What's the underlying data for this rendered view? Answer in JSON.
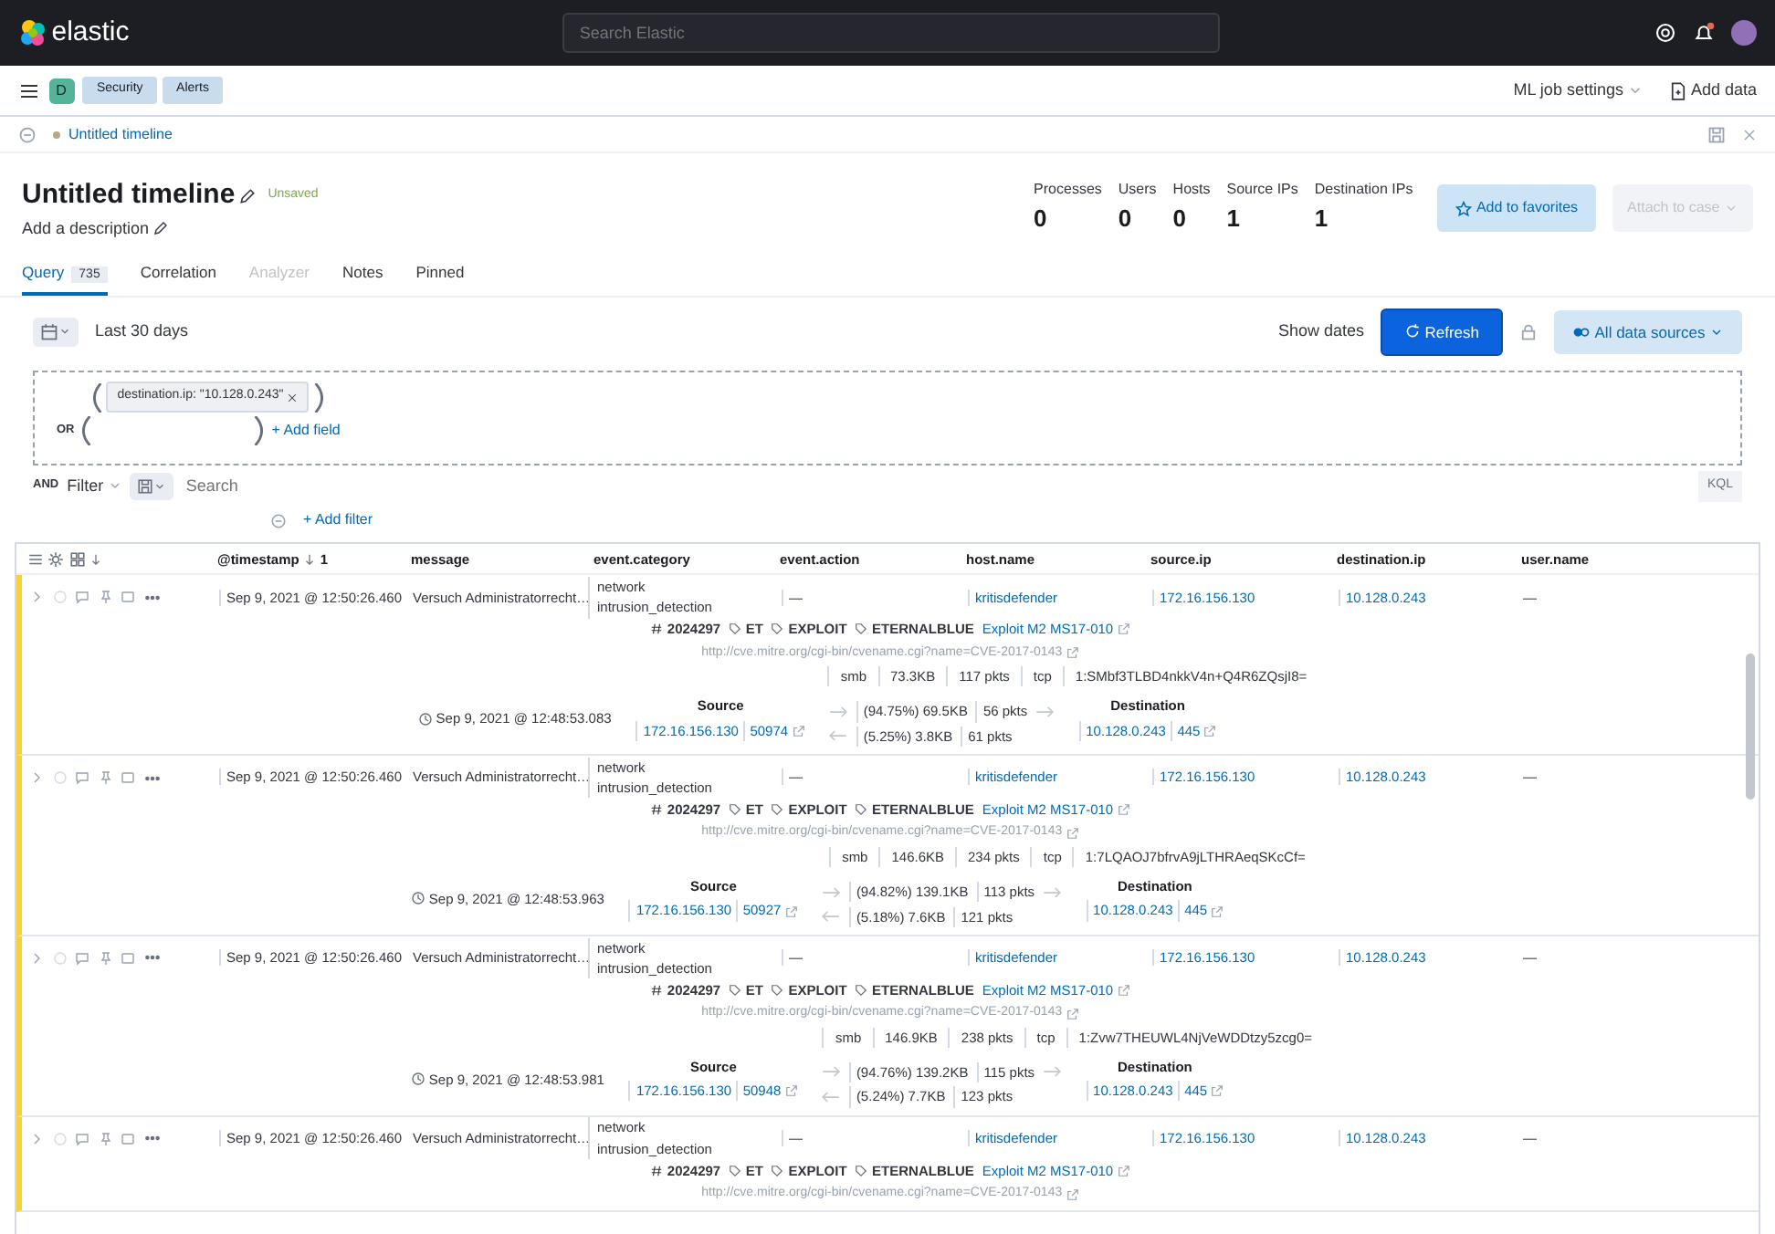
{
  "header": {
    "logo": "elastic",
    "search_placeholder": "Search Elastic"
  },
  "nav": {
    "space_badge": "D",
    "breadcrumbs": [
      "Security",
      "Alerts"
    ],
    "links": [
      {
        "label": "ML job settings",
        "kind": "dropdown"
      },
      {
        "label": "Add data",
        "kind": "add"
      }
    ]
  },
  "timeline_bar": {
    "title": "Untitled timeline"
  },
  "timeline": {
    "title": "Untitled timeline",
    "status": "Unsaved",
    "description": "Add a description",
    "stats": [
      {
        "label": "Processes",
        "value": "0"
      },
      {
        "label": "Users",
        "value": "0"
      },
      {
        "label": "Hosts",
        "value": "0"
      },
      {
        "label": "Source IPs",
        "value": "1"
      },
      {
        "label": "Destination IPs",
        "value": "1"
      }
    ],
    "buttons": [
      {
        "label": "Add to favorites",
        "kind": "favorite",
        "disabled": false
      },
      {
        "label": "Attach to case",
        "kind": "dropdown",
        "disabled": true
      }
    ]
  },
  "tabs": [
    {
      "label": "Query",
      "count": "735",
      "selected": true,
      "disabled": false
    },
    {
      "label": "Correlation",
      "selected": false,
      "disabled": false
    },
    {
      "label": "Analyzer",
      "selected": false,
      "disabled": true
    },
    {
      "label": "Notes",
      "selected": false,
      "disabled": false
    },
    {
      "label": "Pinned",
      "selected": false,
      "disabled": false
    }
  ],
  "date_bar": {
    "range": "Last 30 days",
    "show_dates": "Show dates",
    "refresh": "Refresh",
    "data_sources": "All data sources"
  },
  "query_builder": {
    "pills": [
      "destination.ip: \"10.128.0.243\""
    ],
    "or_label": "OR",
    "add_field": "+ Add field"
  },
  "filter_bar": {
    "and_label": "AND",
    "filter": "Filter",
    "placeholder": "Search",
    "language": "KQL",
    "add_filter": "+ Add filter"
  },
  "table": {
    "columns": [
      {
        "label": "@timestamp",
        "sort_order": "1"
      },
      {
        "label": "message"
      },
      {
        "label": "event.category"
      },
      {
        "label": "event.action"
      },
      {
        "label": "host.name"
      },
      {
        "label": "source.ip"
      },
      {
        "label": "destination.ip"
      },
      {
        "label": "user.name"
      }
    ],
    "rows": [
      {
        "timestamp": "Sep 9, 2021 @ 12:50:26.460",
        "message": "Versuch Administratorrecht…",
        "category": [
          "network",
          "intrusion_detection"
        ],
        "action": "—",
        "host": "kritisdefender",
        "source_ip": "172.16.156.130",
        "destination_ip": "10.128.0.243",
        "user": "—",
        "signature": {
          "id": "2024297",
          "tags": [
            "ET",
            "EXPLOIT",
            "ETERNALBLUE"
          ],
          "link": "Exploit M2 MS17-010",
          "url": "http://cve.mitre.org/cgi-bin/cvename.cgi?name=CVE-2017-0143"
        },
        "network": {
          "protocol": "smb",
          "bytes": "73.3KB",
          "packets": "117 pkts",
          "transport": "tcp",
          "community_id": "1:SMbf3TLBD4nkkV4n+Q4R6ZQsjI8="
        },
        "flow": {
          "time": "Sep 9, 2021 @ 12:48:53.083",
          "source_label": "Source",
          "source_ip": "172.16.156.130",
          "source_port": "50974",
          "out_bytes": "(94.75%) 69.5KB",
          "out_packets": "56 pkts",
          "in_bytes": "(5.25%) 3.8KB",
          "in_packets": "61 pkts",
          "destination_label": "Destination",
          "destination_ip": "10.128.0.243",
          "destination_port": "445"
        }
      },
      {
        "timestamp": "Sep 9, 2021 @ 12:50:26.460",
        "message": "Versuch Administratorrecht…",
        "category": [
          "network",
          "intrusion_detection"
        ],
        "action": "—",
        "host": "kritisdefender",
        "source_ip": "172.16.156.130",
        "destination_ip": "10.128.0.243",
        "user": "—",
        "signature": {
          "id": "2024297",
          "tags": [
            "ET",
            "EXPLOIT",
            "ETERNALBLUE"
          ],
          "link": "Exploit M2 MS17-010",
          "url": "http://cve.mitre.org/cgi-bin/cvename.cgi?name=CVE-2017-0143"
        },
        "network": {
          "protocol": "smb",
          "bytes": "146.6KB",
          "packets": "234 pkts",
          "transport": "tcp",
          "community_id": "1:7LQAOJ7bfrvA9jLTHRAeqSKcCf="
        },
        "flow": {
          "time": "Sep 9, 2021 @ 12:48:53.963",
          "source_label": "Source",
          "source_ip": "172.16.156.130",
          "source_port": "50927",
          "out_bytes": "(94.82%) 139.1KB",
          "out_packets": "113 pkts",
          "in_bytes": "(5.18%) 7.6KB",
          "in_packets": "121 pkts",
          "destination_label": "Destination",
          "destination_ip": "10.128.0.243",
          "destination_port": "445"
        }
      },
      {
        "timestamp": "Sep 9, 2021 @ 12:50:26.460",
        "message": "Versuch Administratorrecht…",
        "category": [
          "network",
          "intrusion_detection"
        ],
        "action": "—",
        "host": "kritisdefender",
        "source_ip": "172.16.156.130",
        "destination_ip": "10.128.0.243",
        "user": "—",
        "signature": {
          "id": "2024297",
          "tags": [
            "ET",
            "EXPLOIT",
            "ETERNALBLUE"
          ],
          "link": "Exploit M2 MS17-010",
          "url": "http://cve.mitre.org/cgi-bin/cvename.cgi?name=CVE-2017-0143"
        },
        "network": {
          "protocol": "smb",
          "bytes": "146.9KB",
          "packets": "238 pkts",
          "transport": "tcp",
          "community_id": "1:Zvw7THEUWL4NjVeWDDtzy5zcg0="
        },
        "flow": {
          "time": "Sep 9, 2021 @ 12:48:53.981",
          "source_label": "Source",
          "source_ip": "172.16.156.130",
          "source_port": "50948",
          "out_bytes": "(94.76%) 139.2KB",
          "out_packets": "115 pkts",
          "in_bytes": "(5.24%) 7.7KB",
          "in_packets": "123 pkts",
          "destination_label": "Destination",
          "destination_ip": "10.128.0.243",
          "destination_port": "445"
        }
      },
      {
        "timestamp": "Sep 9, 2021 @ 12:50:26.460",
        "message": "Versuch Administratorrecht…",
        "category": [
          "network",
          "intrusion_detection"
        ],
        "action": "—",
        "host": "kritisdefender",
        "source_ip": "172.16.156.130",
        "destination_ip": "10.128.0.243",
        "user": "—",
        "signature": {
          "id": "2024297",
          "tags": [
            "ET",
            "EXPLOIT",
            "ETERNALBLUE"
          ],
          "link": "Exploit M2 MS17-010",
          "url": "http://cve.mitre.org/cgi-bin/cvename.cgi?name=CVE-2017-0143"
        }
      }
    ]
  }
}
